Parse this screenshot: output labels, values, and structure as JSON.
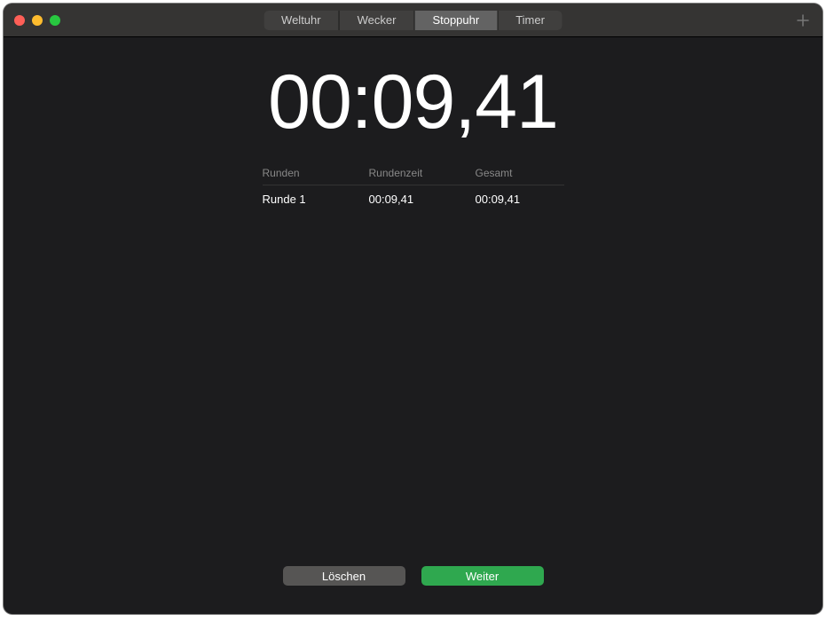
{
  "tabs": {
    "worldclock": "Weltuhr",
    "alarm": "Wecker",
    "stopwatch": "Stoppuhr",
    "timer": "Timer"
  },
  "stopwatch": {
    "time": "00:09,41",
    "headers": {
      "lap": "Runden",
      "laptime": "Rundenzeit",
      "total": "Gesamt"
    },
    "laps": [
      {
        "name": "Runde 1",
        "laptime": "00:09,41",
        "total": "00:09,41"
      }
    ]
  },
  "buttons": {
    "clear": "Löschen",
    "resume": "Weiter"
  }
}
